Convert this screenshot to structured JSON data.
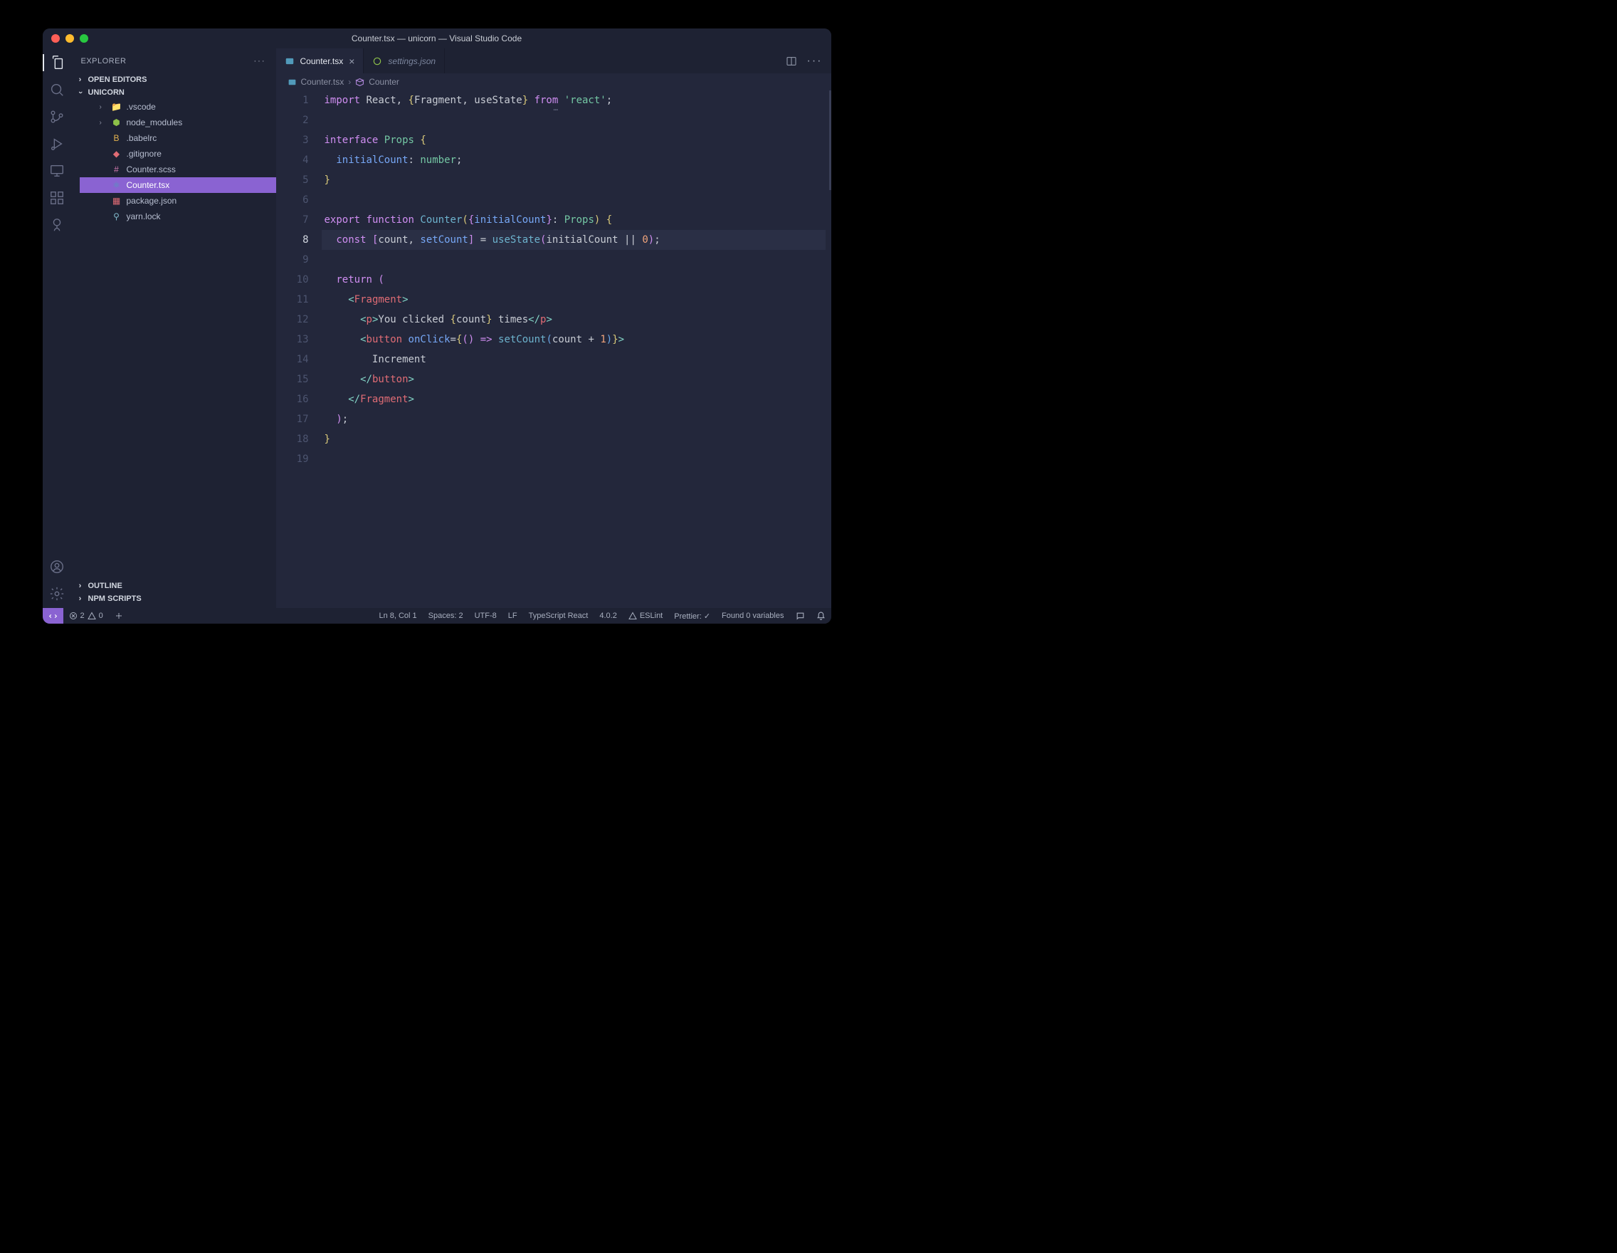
{
  "window": {
    "title": "Counter.tsx — unicorn — Visual Studio Code"
  },
  "sidebar": {
    "title": "EXPLORER",
    "sections": {
      "openEditors": "OPEN EDITORS",
      "project": "UNICORN",
      "outline": "OUTLINE",
      "npm": "NPM SCRIPTS"
    },
    "files": [
      {
        "name": ".vscode",
        "icon": "folder",
        "expandable": true
      },
      {
        "name": "node_modules",
        "icon": "nodejs",
        "expandable": true
      },
      {
        "name": ".babelrc",
        "icon": "babel"
      },
      {
        "name": ".gitignore",
        "icon": "git"
      },
      {
        "name": "Counter.scss",
        "icon": "scss"
      },
      {
        "name": "Counter.tsx",
        "icon": "react",
        "selected": true
      },
      {
        "name": "package.json",
        "icon": "npm"
      },
      {
        "name": "yarn.lock",
        "icon": "yarn"
      }
    ]
  },
  "tabs": [
    {
      "label": "Counter.tsx",
      "active": true,
      "dirty": false
    },
    {
      "label": "settings.json",
      "active": false,
      "italic": true
    }
  ],
  "breadcrumbs": {
    "file": "Counter.tsx",
    "symbol": "Counter"
  },
  "editor": {
    "currentLine": 8,
    "lines": [
      {
        "n": 1,
        "tokens": [
          [
            "kw",
            "import"
          ],
          [
            "plain",
            " React"
          ],
          [
            "punct",
            ", "
          ],
          [
            "brace-y",
            "{"
          ],
          [
            "plain",
            "Fragment"
          ],
          [
            "punct",
            ", "
          ],
          [
            "plain",
            "useState"
          ],
          [
            "brace-y",
            "}"
          ],
          [
            "plain",
            " "
          ],
          [
            "kw",
            "from"
          ],
          [
            "plain",
            " "
          ],
          [
            "str",
            "'react'"
          ],
          [
            "punct",
            ";"
          ]
        ]
      },
      {
        "n": 2,
        "tokens": []
      },
      {
        "n": 3,
        "tokens": [
          [
            "kw",
            "interface"
          ],
          [
            "plain",
            " "
          ],
          [
            "type",
            "Props"
          ],
          [
            "plain",
            " "
          ],
          [
            "brace-y",
            "{"
          ]
        ]
      },
      {
        "n": 4,
        "tokens": [
          [
            "plain",
            "  "
          ],
          [
            "attr",
            "initialCount"
          ],
          [
            "punct",
            ": "
          ],
          [
            "type",
            "number"
          ],
          [
            "punct",
            ";"
          ]
        ]
      },
      {
        "n": 5,
        "tokens": [
          [
            "brace-y",
            "}"
          ]
        ]
      },
      {
        "n": 6,
        "tokens": []
      },
      {
        "n": 7,
        "tokens": [
          [
            "kw",
            "export"
          ],
          [
            "plain",
            " "
          ],
          [
            "kw",
            "function"
          ],
          [
            "plain",
            " "
          ],
          [
            "fn",
            "Counter"
          ],
          [
            "brace-y",
            "("
          ],
          [
            "brace-p",
            "{"
          ],
          [
            "attr",
            "initialCount"
          ],
          [
            "brace-p",
            "}"
          ],
          [
            "punct",
            ": "
          ],
          [
            "type",
            "Props"
          ],
          [
            "brace-y",
            ")"
          ],
          [
            "plain",
            " "
          ],
          [
            "brace-y",
            "{"
          ]
        ]
      },
      {
        "n": 8,
        "tokens": [
          [
            "plain",
            "  "
          ],
          [
            "kw",
            "const"
          ],
          [
            "plain",
            " "
          ],
          [
            "brace-p",
            "["
          ],
          [
            "plain",
            "count"
          ],
          [
            "punct",
            ", "
          ],
          [
            "attr",
            "setCount"
          ],
          [
            "brace-p",
            "]"
          ],
          [
            "plain",
            " "
          ],
          [
            "punct",
            "="
          ],
          [
            "plain",
            " "
          ],
          [
            "fn",
            "useState"
          ],
          [
            "brace-p",
            "("
          ],
          [
            "plain",
            "initialCount "
          ],
          [
            "punct",
            "||"
          ],
          [
            "plain",
            " "
          ],
          [
            "num",
            "0"
          ],
          [
            "brace-p",
            ")"
          ],
          [
            "punct",
            ";"
          ]
        ]
      },
      {
        "n": 9,
        "tokens": []
      },
      {
        "n": 10,
        "tokens": [
          [
            "plain",
            "  "
          ],
          [
            "kw",
            "return"
          ],
          [
            "plain",
            " "
          ],
          [
            "brace-p",
            "("
          ]
        ]
      },
      {
        "n": 11,
        "tokens": [
          [
            "plain",
            "    "
          ],
          [
            "op",
            "<"
          ],
          [
            "tag",
            "Fragment"
          ],
          [
            "op",
            ">"
          ]
        ]
      },
      {
        "n": 12,
        "tokens": [
          [
            "plain",
            "      "
          ],
          [
            "op",
            "<"
          ],
          [
            "tag",
            "p"
          ],
          [
            "op",
            ">"
          ],
          [
            "plain",
            "You clicked "
          ],
          [
            "brace-y",
            "{"
          ],
          [
            "plain",
            "count"
          ],
          [
            "brace-y",
            "}"
          ],
          [
            "plain",
            " times"
          ],
          [
            "op",
            "</"
          ],
          [
            "tag",
            "p"
          ],
          [
            "op",
            ">"
          ]
        ]
      },
      {
        "n": 13,
        "tokens": [
          [
            "plain",
            "      "
          ],
          [
            "op",
            "<"
          ],
          [
            "tag",
            "button"
          ],
          [
            "plain",
            " "
          ],
          [
            "attr",
            "onClick"
          ],
          [
            "punct",
            "="
          ],
          [
            "brace-y",
            "{"
          ],
          [
            "brace-p",
            "()"
          ],
          [
            "plain",
            " "
          ],
          [
            "kw",
            "=>"
          ],
          [
            "plain",
            " "
          ],
          [
            "fn",
            "setCount"
          ],
          [
            "brace-b",
            "("
          ],
          [
            "plain",
            "count "
          ],
          [
            "punct",
            "+"
          ],
          [
            "plain",
            " "
          ],
          [
            "num",
            "1"
          ],
          [
            "brace-b",
            ")"
          ],
          [
            "brace-y",
            "}"
          ],
          [
            "op",
            ">"
          ]
        ]
      },
      {
        "n": 14,
        "tokens": [
          [
            "plain",
            "        Increment"
          ]
        ]
      },
      {
        "n": 15,
        "tokens": [
          [
            "plain",
            "      "
          ],
          [
            "op",
            "</"
          ],
          [
            "tag",
            "button"
          ],
          [
            "op",
            ">"
          ]
        ]
      },
      {
        "n": 16,
        "tokens": [
          [
            "plain",
            "    "
          ],
          [
            "op",
            "</"
          ],
          [
            "tag",
            "Fragment"
          ],
          [
            "op",
            ">"
          ]
        ]
      },
      {
        "n": 17,
        "tokens": [
          [
            "plain",
            "  "
          ],
          [
            "brace-p",
            ")"
          ],
          [
            "punct",
            ";"
          ]
        ]
      },
      {
        "n": 18,
        "tokens": [
          [
            "brace-y",
            "}"
          ]
        ]
      },
      {
        "n": 19,
        "tokens": []
      }
    ]
  },
  "status": {
    "errors": "2",
    "warnings": "0",
    "position": "Ln 8, Col 1",
    "spaces": "Spaces: 2",
    "encoding": "UTF-8",
    "eol": "LF",
    "language": "TypeScript React",
    "version": "4.0.2",
    "eslint": "ESLint",
    "prettier": "Prettier: ✓",
    "variables": "Found 0 variables"
  }
}
